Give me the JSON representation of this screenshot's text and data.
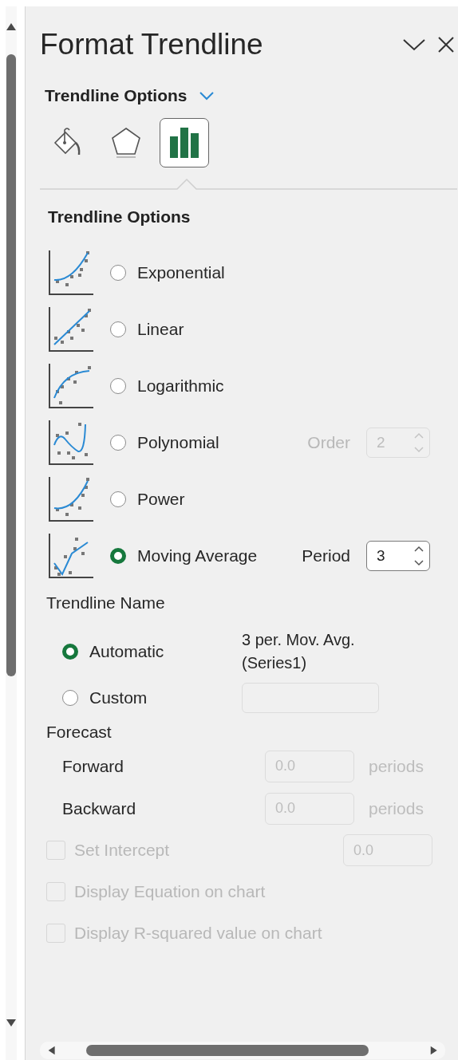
{
  "pane": {
    "title": "Format Trendline",
    "section_menu": "Trendline Options",
    "tabs": [
      {
        "kind": "fill",
        "selected": false
      },
      {
        "kind": "effects",
        "selected": false
      },
      {
        "kind": "options",
        "selected": true
      }
    ]
  },
  "heading": "Trendline Options",
  "types": [
    {
      "kind": "exponential",
      "label": "Exponential",
      "selected": false
    },
    {
      "kind": "linear",
      "label": "Linear",
      "selected": false
    },
    {
      "kind": "logarithmic",
      "label": "Logarithmic",
      "selected": false
    },
    {
      "kind": "polynomial",
      "label": "Polynomial",
      "selected": false,
      "spinner": {
        "label": "Order",
        "value": "2",
        "disabled": true
      }
    },
    {
      "kind": "power",
      "label": "Power",
      "selected": false
    },
    {
      "kind": "moving",
      "label": "Moving Average",
      "selected": true,
      "spinner": {
        "label": "Period",
        "value": "3",
        "disabled": false
      }
    }
  ],
  "name": {
    "heading": "Trendline Name",
    "options": [
      {
        "label": "Automatic",
        "selected": true,
        "value": "3 per. Mov. Avg. (Series1)"
      },
      {
        "label": "Custom",
        "selected": false,
        "field_disabled": true
      }
    ]
  },
  "forecast": {
    "heading": "Forecast",
    "rows": [
      {
        "label": "Forward",
        "value": "0.0",
        "unit": "periods",
        "disabled": true
      },
      {
        "label": "Backward",
        "value": "0.0",
        "unit": "periods",
        "disabled": true
      }
    ]
  },
  "checks": [
    {
      "label": "Set Intercept",
      "checked": false,
      "disabled": true,
      "value": "0.0"
    },
    {
      "label": "Display Equation on chart",
      "checked": false,
      "disabled": true
    },
    {
      "label": "Display R-squared value on chart",
      "checked": false,
      "disabled": true
    }
  ]
}
